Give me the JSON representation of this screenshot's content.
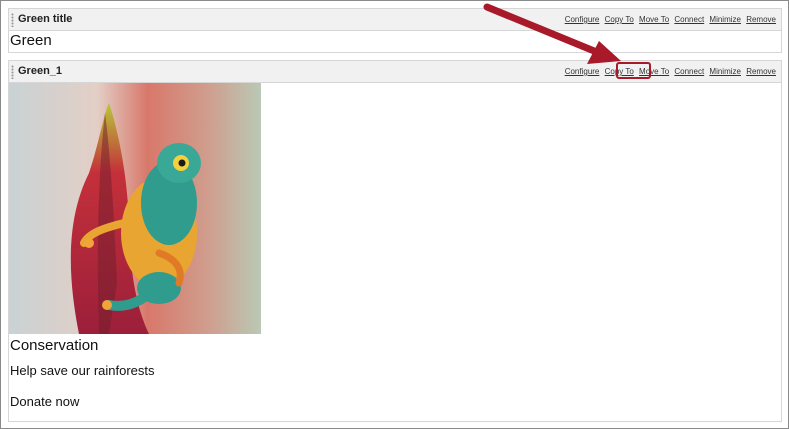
{
  "portlets": [
    {
      "title": "Green title",
      "content_title": "Green",
      "actions": [
        "Configure",
        "Copy To",
        "Move To",
        "Connect",
        "Minimize",
        "Remove"
      ]
    },
    {
      "title": "Green_1",
      "actions": [
        "Configure",
        "Copy To",
        "Move To",
        "Connect",
        "Minimize",
        "Remove"
      ],
      "image_subject": "tree frog on red heliconia flower",
      "heading": "Conservation",
      "subheading": "Help save our rainforests",
      "cta": "Donate now"
    }
  ],
  "annotation": {
    "highlighted_action": "Copy To",
    "color": "#a8192a"
  }
}
